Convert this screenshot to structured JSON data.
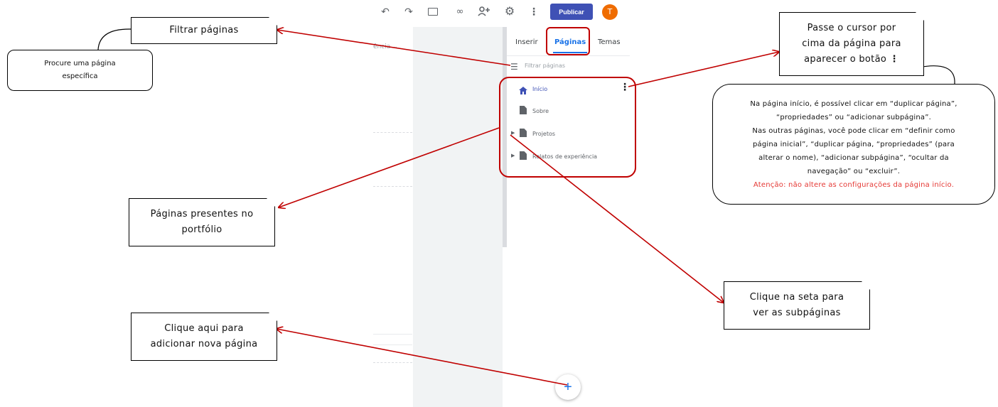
{
  "toolbar": {
    "undo_icon": "undo-icon",
    "redo_icon": "redo-icon",
    "preview_icon": "devices-icon",
    "link_icon": "link-icon",
    "share_icon": "add-person-icon",
    "settings_icon": "gear-icon",
    "more_icon": "more-vert-icon",
    "publish_label": "Publicar",
    "avatar_letter": "T"
  },
  "editor": {
    "crumb": "ência ⌄"
  },
  "panel": {
    "tabs": [
      {
        "label": "Inserir",
        "active": false
      },
      {
        "label": "Páginas",
        "active": true
      },
      {
        "label": "Temas",
        "active": false
      }
    ],
    "filter_placeholder": "Filtrar páginas",
    "pages": [
      {
        "label": "Início",
        "icon": "home-icon",
        "active": true
      },
      {
        "label": "Sobre",
        "icon": "page-icon",
        "active": false
      },
      {
        "label": "Projetos",
        "icon": "page-icon",
        "active": false,
        "has_children": true
      },
      {
        "label": "Relatos de experiência",
        "icon": "page-icon",
        "active": false,
        "has_children": true
      }
    ],
    "page_more_icon": "more-vert-icon",
    "add_page_glyph": "+"
  },
  "annotations": {
    "filter_title": "Filtrar  páginas",
    "filter_note_line1": "Procure  uma  página",
    "filter_note_line2": "específica",
    "pages_present_line1": "Páginas  presentes  no",
    "pages_present_line2": "portfólio",
    "add_page_line1": "Clique  aqui  para",
    "add_page_line2": "adicionar  nova  página",
    "hover_line1": "Passe  o  cursor  por",
    "hover_line2": "cima  da  página  para",
    "hover_line3": "aparecer  o  botão",
    "hover_glyph": "⋮",
    "arrow_line1": "Clique  na  seta  para",
    "arrow_line2": "ver  as  subpáginas",
    "note_line1": "Na  página  início,  é  possível  clicar  em  “duplicar  página”,",
    "note_line2": "“propriedades”  ou  “adicionar  subpágina”.",
    "note_line3": "Nas  outras  páginas,  você  pode  clicar  em  “definir  como",
    "note_line4": "página  inicial”,  “duplicar  página,  “propriedades”  (para",
    "note_line5": "alterar  o  nome),  “adicionar  subpágina”,  “ocultar  da",
    "note_line6": "navegação”  ou  “excluir”.",
    "note_warning": "Atenção:  não  altere  as  configurações  da  página  início."
  },
  "colors": {
    "annotation_red": "#c00000",
    "accent_blue": "#1a73e8",
    "publish_blue": "#3f51b5",
    "avatar_orange": "#ef6c00",
    "warning_red": "#e53935"
  }
}
